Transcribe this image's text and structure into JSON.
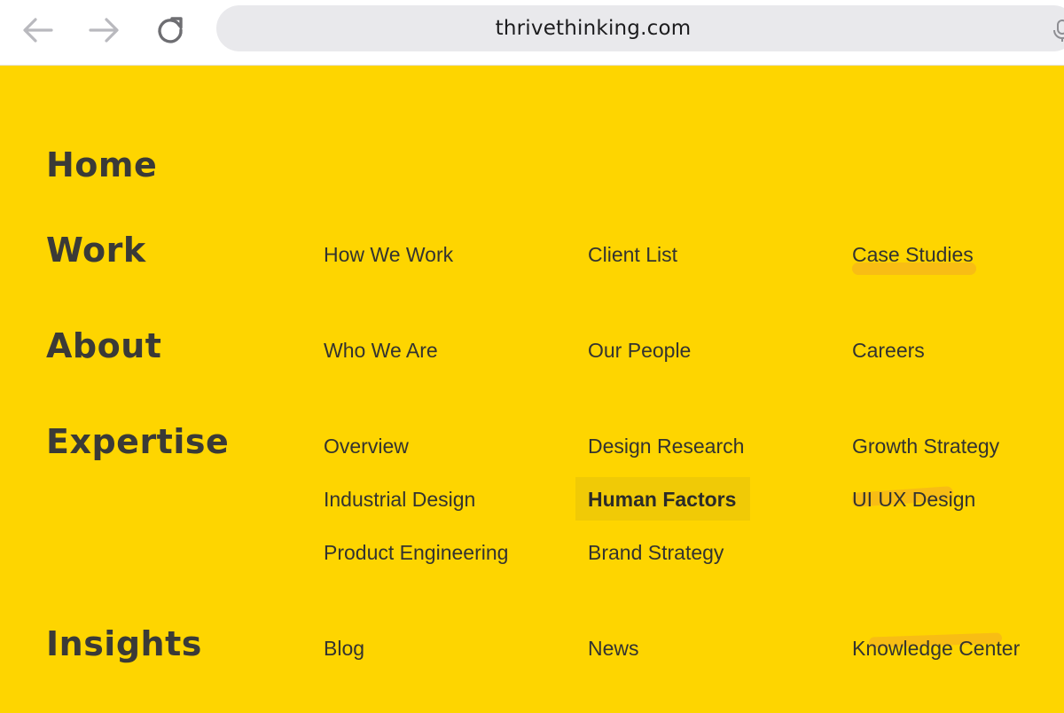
{
  "browser": {
    "url": "thrivethinking.com",
    "icons": [
      "back-arrow-icon",
      "forward-arrow-icon",
      "reload-icon",
      "microphone-icon"
    ]
  },
  "menu": {
    "home": {
      "label": "Home"
    },
    "work": {
      "label": "Work",
      "links": [
        "How We Work",
        "Client List",
        "Case Studies"
      ]
    },
    "about": {
      "label": "About",
      "links": [
        "Who We Are",
        "Our People",
        "Careers"
      ]
    },
    "expertise": {
      "label": "Expertise",
      "links": [
        "Overview",
        "Design Research",
        "Growth Strategy",
        "Industrial Design",
        "Human Factors",
        "UI UX Design",
        "Product Engineering",
        "Brand Strategy"
      ],
      "active": "Human Factors"
    },
    "insights": {
      "label": "Insights",
      "links": [
        "Blog",
        "News",
        "Knowledge Center"
      ]
    }
  },
  "colors": {
    "background": "#fed500",
    "text": "#3a3a37",
    "active_background": "#f0ca06",
    "marker_highlight": "#f7b818"
  }
}
